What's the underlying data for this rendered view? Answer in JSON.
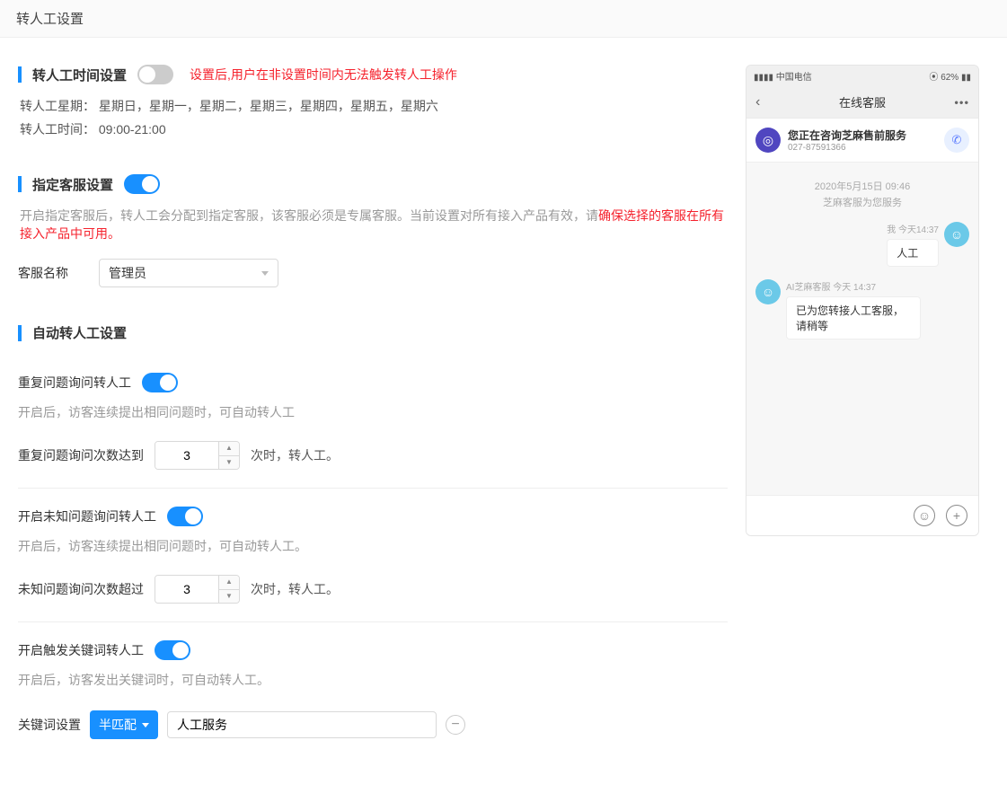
{
  "page_title": "转人工设置",
  "section_time": {
    "title": "转人工时间设置",
    "toggle": false,
    "hint": "设置后,用户在非设置时间内无法触发转人工操作",
    "weekday_label": "转人工星期：",
    "weekday_value": "星期日，星期一，星期二，星期三，星期四，星期五，星期六",
    "time_label": "转人工时间：",
    "time_value": "09:00-21:00"
  },
  "section_agent": {
    "title": "指定客服设置",
    "toggle": true,
    "desc_prefix": "开启指定客服后，转人工会分配到指定客服，该客服必须是专属客服。当前设置对所有接入产品有效，请",
    "desc_warn": "确保选择的客服在所有接入产品中可用。",
    "name_label": "客服名称",
    "name_value": "管理员"
  },
  "section_auto": {
    "title": "自动转人工设置",
    "repeat": {
      "label": "重复问题询问转人工",
      "toggle": true,
      "desc": "开启后，访客连续提出相同问题时，可自动转人工",
      "count_prefix": "重复问题询问次数达到",
      "count_value": "3",
      "count_suffix": "次时，转人工。"
    },
    "unknown": {
      "label": "开启未知问题询问转人工",
      "toggle": true,
      "desc": "开启后，访客连续提出相同问题时，可自动转人工。",
      "count_prefix": "未知问题询问次数超过",
      "count_value": "3",
      "count_suffix": "次时，转人工。"
    },
    "keyword": {
      "label": "开启触发关键词转人工",
      "toggle": true,
      "desc": "开启后，访客发出关键词时，可自动转人工。",
      "setting_label": "关键词设置",
      "match_mode": "半匹配",
      "input_value": "人工服务"
    }
  },
  "preview": {
    "status_left": "中国电信",
    "status_right": "62%",
    "header_title": "在线客服",
    "service_name": "您正在咨询芝麻售前服务",
    "service_phone": "027-87591366",
    "chat_date": "2020年5月15日 09:46",
    "chat_sub": "芝麻客服为您服务",
    "user_meta": "我 今天14:37",
    "user_msg": "人工",
    "bot_meta": "AI芝麻客服 今天 14:37",
    "bot_msg": "已为您转接人工客服，请稍等"
  }
}
